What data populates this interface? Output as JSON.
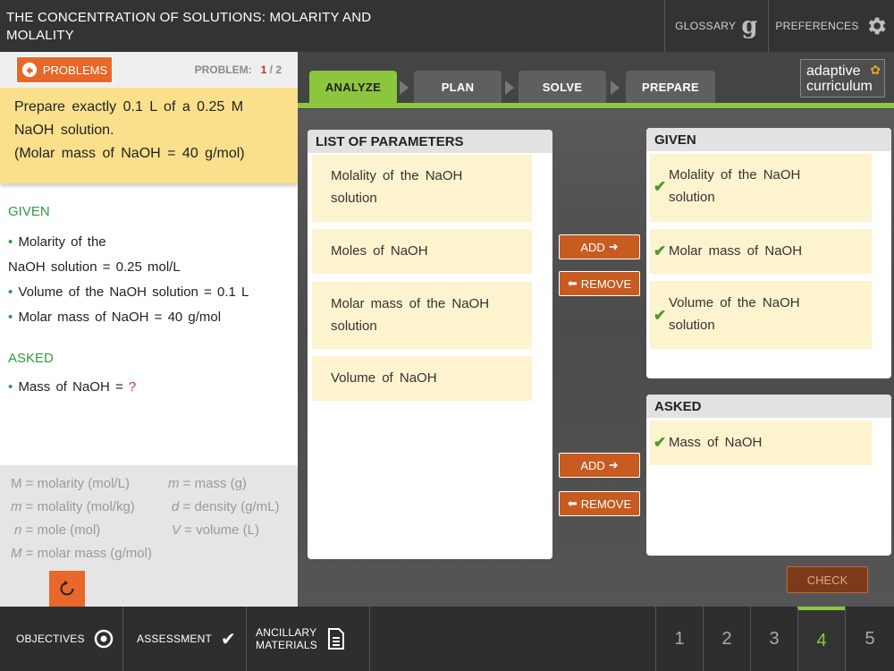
{
  "header": {
    "title": "THE CONCENTRATION OF SOLUTIONS: MOLARITY AND MOLALITY",
    "glossary_label": "GLOSSARY",
    "glossary_icon": "g",
    "preferences_label": "PREFERENCES"
  },
  "problem": {
    "button_label": "PROBLEMS",
    "counter_label": "PROBLEM:",
    "current": "1",
    "total": "/ 2",
    "prompt_line1": "Prepare exactly 0.1 L of a 0.25 M",
    "prompt_line2": "NaOH solution.",
    "prompt_line3": "(Molar mass of NaOH = 40 g/mol)"
  },
  "summary": {
    "given_heading": "GIVEN",
    "given": [
      {
        "line1": "Molarity of the",
        "line2": "NaOH solution = 0.25 mol/L"
      },
      {
        "line1": "Volume of the NaOH solution = 0.1 L"
      },
      {
        "line1": "Molar mass of NaOH = 40 g/mol"
      }
    ],
    "asked_heading": "ASKED",
    "asked": [
      {
        "text": "Mass of NaOH = ",
        "unknown": "?"
      }
    ],
    "bullet": "•"
  },
  "legend": {
    "M": "M",
    "M_def": " = molarity (mol/L)",
    "mm": "m",
    "mm_def": " = mass (g)",
    "m": "m",
    "m_def": " = molality (mol/kg)",
    "d": "d",
    "d_def": " = density (g/mL)",
    "n": "n",
    "n_def": " = mole (mol)",
    "V": "V",
    "V_def": " = volume (L)",
    "Mm": "M",
    "Mm_def": " = molar mass (g/mol)"
  },
  "tabs": [
    "ANALYZE",
    "PLAN",
    "SOLVE",
    "PREPARE"
  ],
  "active_tab": "ANALYZE",
  "logo": {
    "line1": "adaptive",
    "line2": "curriculum"
  },
  "parameters": {
    "heading": "LIST OF PARAMETERS",
    "items": [
      {
        "line1": "Molality of the NaOH",
        "line2": "solution"
      },
      {
        "line1": "Moles of NaOH"
      },
      {
        "line1": "Molar mass of the NaOH",
        "line2": "solution"
      },
      {
        "line1": "Volume of NaOH"
      }
    ]
  },
  "given_panel": {
    "heading": "GIVEN",
    "items": [
      {
        "line1": "Molality of the NaOH",
        "line2": "solution"
      },
      {
        "line1": "Molar mass of NaOH"
      },
      {
        "line1": "Volume of the NaOH",
        "line2": "solution"
      }
    ]
  },
  "asked_panel": {
    "heading": "ASKED",
    "items": [
      {
        "line1": "Mass of NaOH"
      }
    ]
  },
  "buttons": {
    "add": "ADD",
    "remove": "REMOVE",
    "check": "CHECK"
  },
  "footer": {
    "objectives": "OBJECTIVES",
    "assessment": "ASSESSMENT",
    "ancillary_line1": "ANCILLARY",
    "ancillary_line2": "MATERIALS",
    "pages": [
      "1",
      "2",
      "3",
      "4",
      "5"
    ],
    "active_page": "4"
  },
  "colors": {
    "accent_green": "#8cc63f",
    "accent_orange": "#e8672a",
    "prompt_yellow": "#fbe08c"
  }
}
